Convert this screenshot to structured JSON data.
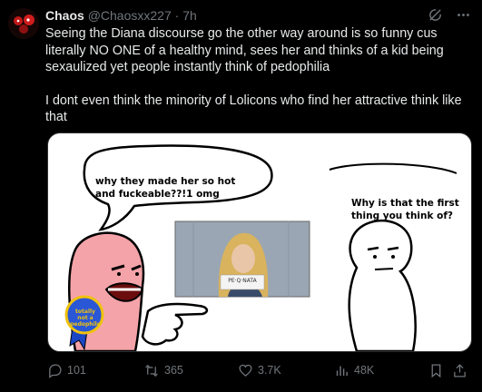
{
  "post": {
    "author_name": "Chaos",
    "handle": "@Chaosxx227",
    "separator": "·",
    "time": "7h",
    "text_p1": "Seeing the Diana discourse go the other way around is so funny cus literally NO ONE of a healthy mind, sees her and thinks of a kid being sexaulized yet people instantly think of pedophilia",
    "text_p2": "I dont even think the minority of Lolicons who find her attractive think like that"
  },
  "media": {
    "bubble_left_text": "why they made her so hot and fuckeable??!1 omg",
    "right_question": "Why is that the first thing you think of?",
    "badge_text": "totally not a pedophile",
    "photo_sign_text": "PE·Q·NATA"
  },
  "actions": {
    "replies": "101",
    "reposts": "365",
    "likes": "3.7K",
    "views": "48K"
  },
  "icons": [
    "grok-icon",
    "more-icon",
    "reply-icon",
    "repost-icon",
    "like-icon",
    "views-icon",
    "bookmark-icon",
    "share-icon"
  ],
  "colors": {
    "background": "#000000",
    "text": "#e7e9ea",
    "muted": "#71767b",
    "media_bg": "#ffffff"
  }
}
